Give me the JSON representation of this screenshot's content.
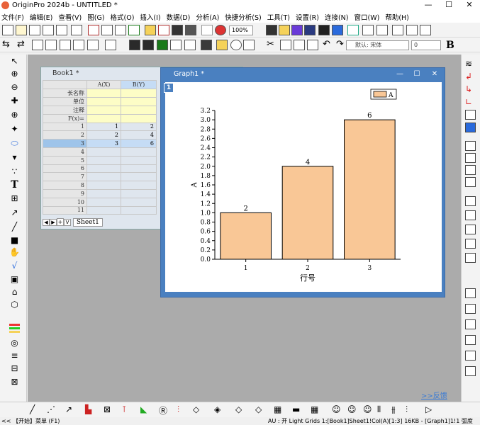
{
  "app": {
    "title": "OriginPro 2024b - UNTITLED *",
    "window_controls": [
      "—",
      "☐",
      "✕"
    ]
  },
  "menu": [
    "文件(F)",
    "编辑(E)",
    "查看(V)",
    "图(G)",
    "格式(O)",
    "插入(I)",
    "数据(D)",
    "分析(A)",
    "快捷分析(S)",
    "工具(T)",
    "设置(R)",
    "连接(N)",
    "窗口(W)",
    "帮助(H)"
  ],
  "toolbar": {
    "zoom": "100%",
    "font_name": "默认: 宋体",
    "font_size": "0"
  },
  "workbook": {
    "title": "Book1 *",
    "columns": [
      "A(X)",
      "B(Y)"
    ],
    "label_rows": [
      "长名称",
      "单位",
      "注释",
      "F(x)="
    ],
    "rows": [
      {
        "n": "1",
        "a": "1",
        "b": "2"
      },
      {
        "n": "2",
        "a": "2",
        "b": "4"
      },
      {
        "n": "3",
        "a": "3",
        "b": "6"
      },
      {
        "n": "4",
        "a": "",
        "b": ""
      },
      {
        "n": "5",
        "a": "",
        "b": ""
      },
      {
        "n": "6",
        "a": "",
        "b": ""
      },
      {
        "n": "7",
        "a": "",
        "b": ""
      },
      {
        "n": "8",
        "a": "",
        "b": ""
      },
      {
        "n": "9",
        "a": "",
        "b": ""
      },
      {
        "n": "10",
        "a": "",
        "b": ""
      },
      {
        "n": "11",
        "a": "",
        "b": ""
      }
    ],
    "sheet_tab": "Sheet1",
    "nav_arrows": [
      "◀",
      "▶",
      "+",
      "V"
    ]
  },
  "graph": {
    "title": "Graph1 *",
    "layer": "1",
    "window_controls": [
      "—",
      "☐",
      "✕"
    ]
  },
  "chart_data": {
    "type": "bar",
    "categories": [
      "1",
      "2",
      "3"
    ],
    "values": [
      2,
      4,
      6
    ],
    "data_labels": [
      "2",
      "4",
      "6"
    ],
    "xlabel": "行号",
    "ylabel": "A",
    "legend": "A",
    "legend_position": "top-right",
    "ylim": [
      0,
      3.2
    ],
    "yticks": [
      "0.0",
      "0.2",
      "0.4",
      "0.6",
      "0.8",
      "1.0",
      "1.2",
      "1.4",
      "1.6",
      "1.8",
      "2.0",
      "2.2",
      "2.4",
      "2.6",
      "2.8",
      "3.0",
      "3.2"
    ],
    "bar_color": "#f9c796",
    "bar_edge": "#000000"
  },
  "feedback_link": ">>反馈",
  "status": {
    "left": "<< 【开始】菜单 (F1)",
    "right": "AU : 开  Light Grids  1:[Book1]Sheet1!Col(A)[1:3]  16KB - [Graph1]1!1  弧度"
  }
}
